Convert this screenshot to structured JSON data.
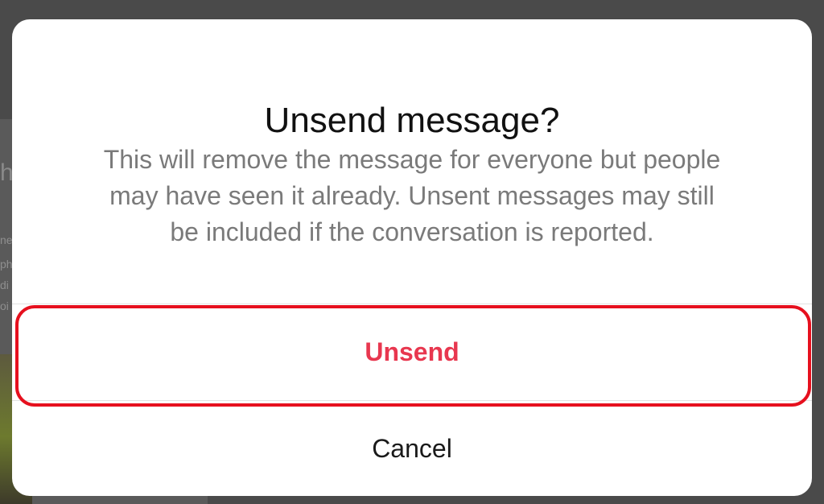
{
  "background": {
    "fragments": [
      "h",
      "ne",
      "ph",
      "di",
      "oi"
    ]
  },
  "dialog": {
    "title": "Unsend message?",
    "body_lines": [
      "This will remove the message for everyone but people",
      "may have seen it already. Unsent messages may still",
      "be included if the conversation is reported."
    ],
    "unsend_label": "Unsend",
    "cancel_label": "Cancel"
  },
  "colors": {
    "destructive": "#e8374f",
    "highlight": "#e6101e",
    "overlay": "#4a4a4a"
  }
}
